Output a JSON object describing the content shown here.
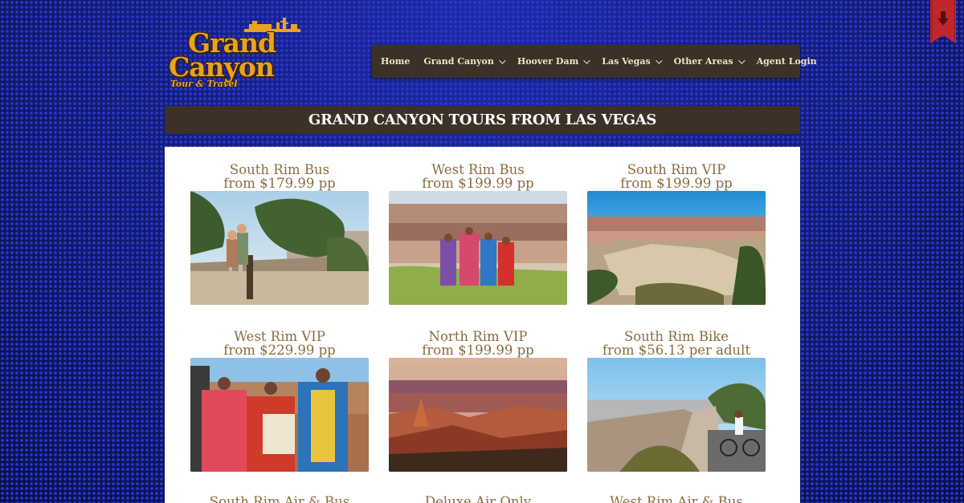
{
  "logo": {
    "line1": "Grand",
    "line2": "Canyon",
    "tagline": "Tour & Travel"
  },
  "nav": {
    "items": [
      {
        "label": "Home",
        "has_dropdown": false
      },
      {
        "label": "Grand Canyon",
        "has_dropdown": true
      },
      {
        "label": "Hoover Dam",
        "has_dropdown": true
      },
      {
        "label": "Las Vegas",
        "has_dropdown": true
      },
      {
        "label": "Other Areas",
        "has_dropdown": true
      },
      {
        "label": "Agent Login",
        "has_dropdown": false
      }
    ]
  },
  "ribbon": {
    "icon": "arrow-down-icon",
    "color": "#c0272d"
  },
  "page_title": "GRAND CANYON TOURS FROM LAS VEGAS",
  "tours": [
    {
      "name": "South Rim Bus",
      "price": "from $179.99 pp",
      "image": "tourists-at-overlook"
    },
    {
      "name": "West Rim Bus",
      "price": "from $199.99 pp",
      "image": "native-girls-canyon"
    },
    {
      "name": "South Rim VIP",
      "price": "from $199.99 pp",
      "image": "south-rim-canyon-view"
    },
    {
      "name": "West Rim VIP",
      "price": "from $229.99 pp",
      "image": "native-dancers"
    },
    {
      "name": "North Rim VIP",
      "price": "from $199.99 pp",
      "image": "north-rim-sunset"
    },
    {
      "name": "South Rim Bike",
      "price": "from $56.13 per adult",
      "image": "cyclist-at-rim"
    },
    {
      "name": "South Rim Air & Bus",
      "price": "",
      "image": ""
    },
    {
      "name": "Deluxe Air Only",
      "price": "",
      "image": ""
    },
    {
      "name": "West Rim Air & Bus",
      "price": "",
      "image": ""
    }
  ],
  "colors": {
    "background": "#0d1460",
    "nav_bg": "#3c3127",
    "nav_text": "#f1e3c4",
    "tour_text": "#8a6d3f",
    "logo_gold": "#e8a321"
  }
}
